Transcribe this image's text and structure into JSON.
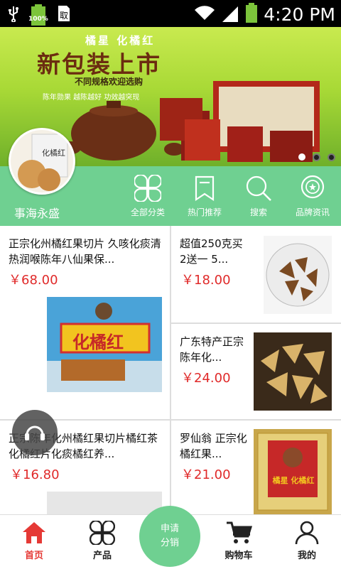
{
  "status_bar": {
    "battery_text": "100%",
    "time": "4:20 PM"
  },
  "banner": {
    "brand": "橘星 化橘红",
    "headline": "新包装上市",
    "subline": "不同规格欢迎选购",
    "tagline": "陈年勋果  越陈越好  功效越突现",
    "product_label": "化橘红",
    "dots": 3
  },
  "shop": {
    "name": "事海永盛",
    "avatar_label": "化橘红"
  },
  "categories": [
    {
      "label": "全部分类",
      "icon": "grid-icon"
    },
    {
      "label": "热门推荐",
      "icon": "bookmark-icon"
    },
    {
      "label": "搜索",
      "icon": "search-icon"
    },
    {
      "label": "品牌资讯",
      "icon": "badge-icon"
    }
  ],
  "products": [
    {
      "title": "正宗化州橘红果切片 久咳化痰清热润喉陈年八仙果保...",
      "price": "￥68.00",
      "image_label": "化橘红"
    },
    {
      "title": "超值250克买2送一 5...",
      "price": "￥18.00"
    },
    {
      "title": "广东特产正宗陈年化...",
      "price": "￥24.00"
    },
    {
      "title": "正宗陈年化州橘红果切片橘红茶化橘红片化痰橘红养...",
      "price": "￥16.80"
    },
    {
      "title": "罗仙翁 正宗化橘红果...",
      "price": "￥21.00",
      "image_label": "橘星 化橘红"
    }
  ],
  "bottom_nav": {
    "home": "首页",
    "products": "产品",
    "apply_line1": "申请",
    "apply_line2": "分销",
    "cart": "购物车",
    "mine": "我的"
  },
  "colors": {
    "accent": "#6fd091",
    "price": "#e02a2a",
    "active_nav": "#e53935"
  }
}
